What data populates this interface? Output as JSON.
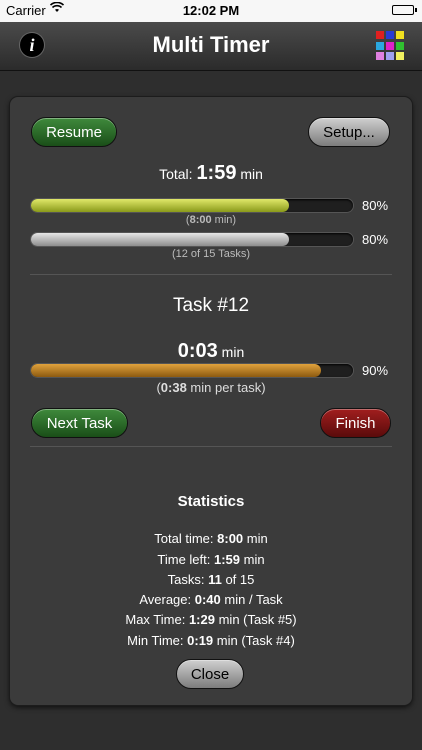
{
  "status_bar": {
    "carrier": "Carrier",
    "time": "12:02 PM"
  },
  "nav": {
    "title": "Multi Timer",
    "info_glyph": "i",
    "grid_colors": [
      "#e02020",
      "#2a3bd6",
      "#f0e020",
      "#2aa8e0",
      "#e020c8",
      "#30c030",
      "#e080e0",
      "#a0a0f0",
      "#f0f060"
    ]
  },
  "controls": {
    "resume_label": "Resume",
    "setup_label": "Setup...",
    "next_task_label": "Next Task",
    "finish_label": "Finish",
    "close_label": "Close"
  },
  "total": {
    "prefix": "Total:",
    "value": "1:59",
    "unit": "min",
    "time_bar_percent": 80,
    "time_bar_label": "80%",
    "time_detail_open": "(",
    "time_detail_value": "8:00",
    "time_detail_close": " min)",
    "tasks_bar_percent": 80,
    "tasks_bar_label": "80%",
    "tasks_detail": "(12 of 15 Tasks)"
  },
  "task": {
    "title": "Task #12",
    "value": "0:03",
    "unit": "min",
    "bar_percent": 90,
    "bar_label": "90%",
    "detail_open": "(",
    "detail_value": "0:38",
    "detail_close": " min per task)"
  },
  "statistics": {
    "heading": "Statistics",
    "total_time": {
      "label": "Total time:",
      "value": "8:00",
      "suffix": " min"
    },
    "time_left": {
      "label": "Time left:",
      "value": "1:59",
      "suffix": " min"
    },
    "tasks": {
      "label": "Tasks:",
      "value": "11",
      "suffix": " of 15"
    },
    "average": {
      "label": "Average:",
      "value": "0:40",
      "suffix": " min / Task"
    },
    "max_time": {
      "label": "Max Time:",
      "value": "1:29",
      "suffix": " min (Task #5)"
    },
    "min_time": {
      "label": "Min Time:",
      "value": "0:19",
      "suffix": " min (Task #4)"
    }
  }
}
